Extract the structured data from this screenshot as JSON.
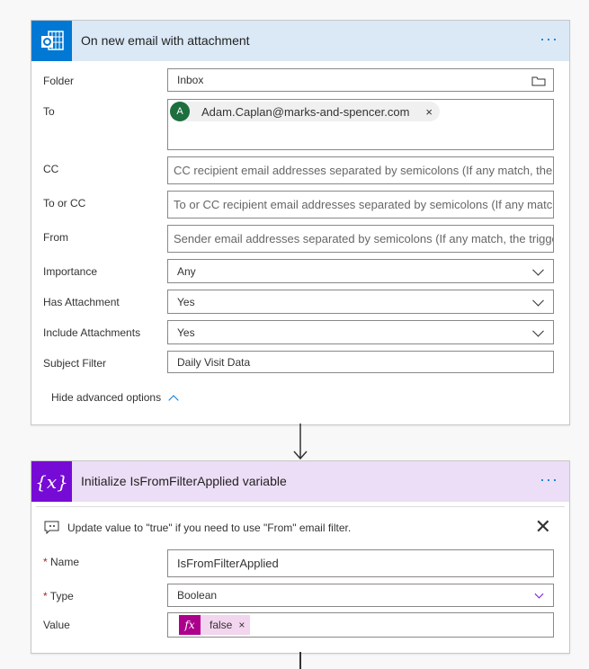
{
  "trigger": {
    "title": "On new email with attachment",
    "icon": "outlook-icon",
    "accent": "#0078d4",
    "fields": {
      "folder": {
        "label": "Folder",
        "value": "Inbox"
      },
      "to": {
        "label": "To",
        "token_initial": "A",
        "token_value": "Adam.Caplan@marks-and-spencer.com"
      },
      "cc": {
        "label": "CC",
        "placeholder": "CC recipient email addresses separated by semicolons (If any match, the trigger will run)"
      },
      "to_or_cc": {
        "label": "To or CC",
        "placeholder": "To or CC recipient email addresses separated by semicolons (If any match, the trigger will run)"
      },
      "from": {
        "label": "From",
        "placeholder": "Sender email addresses separated by semicolons (If any match, the trigger will run)"
      },
      "importance": {
        "label": "Importance",
        "value": "Any"
      },
      "has_attachment": {
        "label": "Has Attachment",
        "value": "Yes"
      },
      "include_attachments": {
        "label": "Include Attachments",
        "value": "Yes"
      },
      "subject_filter": {
        "label": "Subject Filter",
        "value": "Daily Visit Data"
      }
    },
    "advanced_toggle": "Hide advanced options"
  },
  "action": {
    "title": "Initialize IsFromFilterApplied variable",
    "icon": "variable-icon",
    "accent": "#770bd6",
    "comment": "Update value to \"true\" if you need to use \"From\" email filter.",
    "fields": {
      "name": {
        "label": "Name",
        "value": "IsFromFilterApplied"
      },
      "type": {
        "label": "Type",
        "value": "Boolean"
      },
      "value": {
        "label": "Value",
        "token_value": "false",
        "token_icon": "fx"
      }
    }
  }
}
